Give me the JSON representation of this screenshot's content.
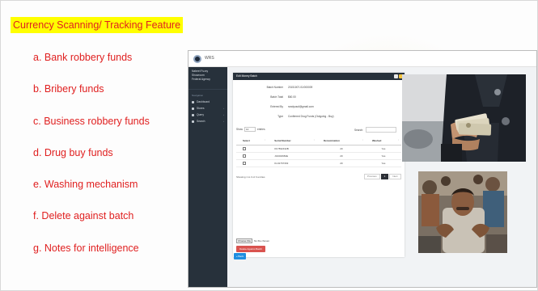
{
  "slide": {
    "title": "Currency Scanning/ Tracking Feature",
    "items": [
      "a.  Bank robbery funds",
      "b.  Bribery funds",
      "c.  Business robbery funds",
      "d.  Drug buy funds",
      "e.  Washing mechanism",
      "f.  Delete against batch",
      "g.  Notes for intelligence"
    ]
  },
  "app": {
    "name": "WRS",
    "user": {
      "name": "Nabeel Fuzzy",
      "role": "Showroom",
      "org": "Federal Agency"
    },
    "nav": {
      "heading": "Navigation",
      "items": [
        {
          "label": "Dashboard",
          "icon": "home-icon"
        },
        {
          "label": "Stores",
          "icon": "store-icon"
        },
        {
          "label": "Query",
          "icon": "query-icon"
        },
        {
          "label": "Search",
          "icon": "search-icon"
        }
      ]
    },
    "panel": {
      "title": "Edit Money Batch",
      "fields": [
        {
          "label": "Batch Number",
          "value": "20151007-01/000009"
        },
        {
          "label": "Batch Total",
          "value": "$60.00"
        },
        {
          "label": "Entered By",
          "value": "randyusuf@gmail.com"
        },
        {
          "label": "Type",
          "value": "Confirmed Drug Funds (Outgoing - Buy)"
        }
      ],
      "show_label": "Show",
      "show_value": "10",
      "entries_label": "entries",
      "search_label": "Search:",
      "columns": [
        "Select",
        "Serial Number",
        "Denomination",
        "Washed"
      ],
      "rows": [
        {
          "serial": "KF7832432B",
          "denomination": "20",
          "washed": "Yes"
        },
        {
          "serial": "J34302684E",
          "denomination": "20",
          "washed": "Yes"
        },
        {
          "serial": "KL91767363",
          "denomination": "20",
          "washed": "Yes"
        }
      ],
      "footer_info": "Showing 1 to 3 of 3 entries",
      "pager": {
        "prev": "Previous",
        "current": "1",
        "next": "Next"
      },
      "file_button": "Choose File",
      "file_status": "No file chosen",
      "delete_button": "Delete Against Batch"
    },
    "back_button": "« Back"
  },
  "colors": {
    "title_highlight": "#ffff00",
    "title_text": "#e02020",
    "sidebar": "#27313b",
    "delete": "#d9534f",
    "back": "#1f8ee0"
  }
}
